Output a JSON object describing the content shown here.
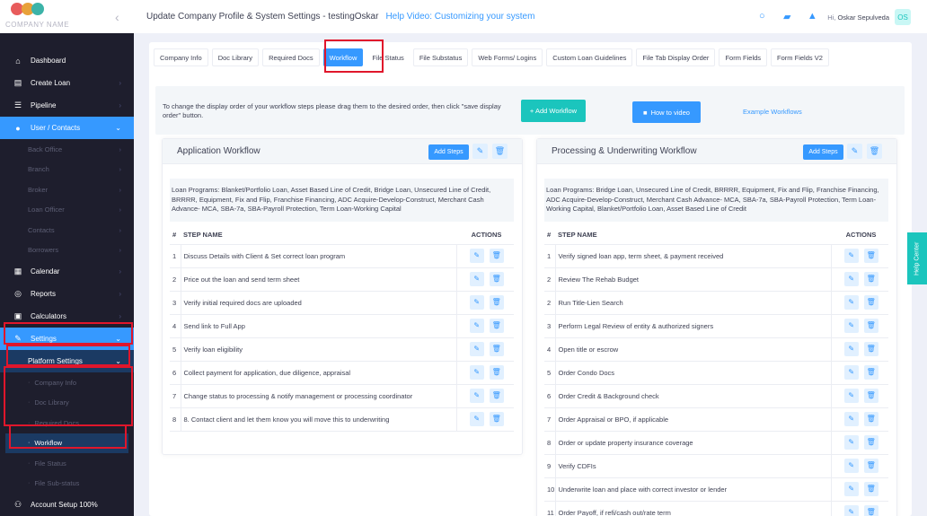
{
  "brand": {
    "company_name": "COMPANY NAME",
    "colors": [
      "#e85c5c",
      "#e8a13a",
      "#3cb3a8"
    ]
  },
  "header": {
    "title": "Update Company Profile & System Settings - testingOskar",
    "help_video": "Help Video: Customizing your system",
    "greeting": "Hi,",
    "user_name": "Oskar Sepulveda",
    "avatar_initials": "OS"
  },
  "sidebar": {
    "items": [
      {
        "label": "Dashboard",
        "icon": "home-icon"
      },
      {
        "label": "Create Loan",
        "icon": "document-icon"
      },
      {
        "label": "Pipeline",
        "icon": "list-icon"
      },
      {
        "label": "User / Contacts",
        "icon": "user-icon"
      }
    ],
    "contacts_sub": [
      "Back Office",
      "Branch",
      "Broker",
      "Loan Officer",
      "Contacts",
      "Borrowers"
    ],
    "items2": [
      {
        "label": "Calendar",
        "icon": "calendar-icon"
      },
      {
        "label": "Reports",
        "icon": "chart-icon"
      },
      {
        "label": "Calculators",
        "icon": "calculator-icon"
      },
      {
        "label": "Settings",
        "icon": "wrench-icon"
      }
    ],
    "platform_settings": "Platform Settings",
    "platform_sub": [
      "Company Info",
      "Doc Library",
      "Required Docs",
      "Workflow",
      "File Status",
      "File Sub-status"
    ],
    "account_setup": "Account Setup 100%"
  },
  "tabs": [
    "Company Info",
    "Doc Library",
    "Required Docs",
    "Workflow",
    "File Status",
    "File Substatus",
    "Web Forms/ Logins",
    "Custom Loan Guidelines",
    "File Tab Display Order",
    "Form Fields",
    "Form Fields V2"
  ],
  "instructions": {
    "text": "To change the display order of your workflow steps please drag them to the desired order, then click \"save display order\" button.",
    "add_workflow": "+ Add Workflow",
    "how_to": "How to video",
    "example": "Example Workflows"
  },
  "workflows": [
    {
      "title": "Application Workflow",
      "add_steps": "Add Steps",
      "programs": "Loan Programs: Blanket/Portfolio Loan, Asset Based Line of Credit, Bridge Loan, Unsecured Line of Credit, BRRRR, Equipment, Fix and Flip, Franchise Financing, ADC Acquire-Develop-Construct, Merchant Cash Advance- MCA, SBA-7a, SBA-Payroll Protection, Term Loan-Working Capital",
      "col_num": "#",
      "col_name": "STEP NAME",
      "col_actions": "ACTIONS",
      "steps": [
        {
          "n": "1",
          "name": "Discuss Details with Client & Set correct loan program"
        },
        {
          "n": "2",
          "name": "Price out the loan and send term sheet"
        },
        {
          "n": "3",
          "name": "Verify initial required docs are uploaded"
        },
        {
          "n": "4",
          "name": "Send link to Full App"
        },
        {
          "n": "5",
          "name": "Verify loan eligibility"
        },
        {
          "n": "6",
          "name": "Collect payment for application, due diligence, appraisal"
        },
        {
          "n": "7",
          "name": "Change status to processing & notify management or processing coordinator"
        },
        {
          "n": "8",
          "name": "8. Contact client and let them know you will move this to underwriting"
        }
      ]
    },
    {
      "title": "Processing & Underwriting Workflow",
      "add_steps": "Add Steps",
      "programs": "Loan Programs: Bridge Loan, Unsecured Line of Credit, BRRRR, Equipment, Fix and Flip, Franchise Financing, ADC Acquire-Develop-Construct, Merchant Cash Advance- MCA, SBA-7a, SBA-Payroll Protection, Term Loan-Working Capital, Blanket/Portfolio Loan, Asset Based Line of Credit",
      "col_num": "#",
      "col_name": "STEP NAME",
      "col_actions": "ACTIONS",
      "steps": [
        {
          "n": "1",
          "name": "Verify signed loan app, term sheet, & payment received"
        },
        {
          "n": "2",
          "name": "Review The Rehab Budget"
        },
        {
          "n": "2",
          "name": "Run Title-Lien Search"
        },
        {
          "n": "3",
          "name": "Perform Legal Review of entity & authorized signers"
        },
        {
          "n": "4",
          "name": "Open title or escrow"
        },
        {
          "n": "5",
          "name": "Order Condo Docs"
        },
        {
          "n": "6",
          "name": "Order Credit & Background check"
        },
        {
          "n": "7",
          "name": "Order Appraisal or BPO, if applicable"
        },
        {
          "n": "8",
          "name": "Order or update property insurance coverage"
        },
        {
          "n": "9",
          "name": "Verify CDFIs"
        },
        {
          "n": "10",
          "name": "Underwrite loan and place with correct investor or lender"
        },
        {
          "n": "11",
          "name": "Order Payoff, if refi/cash out/rate term"
        }
      ]
    }
  ],
  "help_center": "Help Center"
}
